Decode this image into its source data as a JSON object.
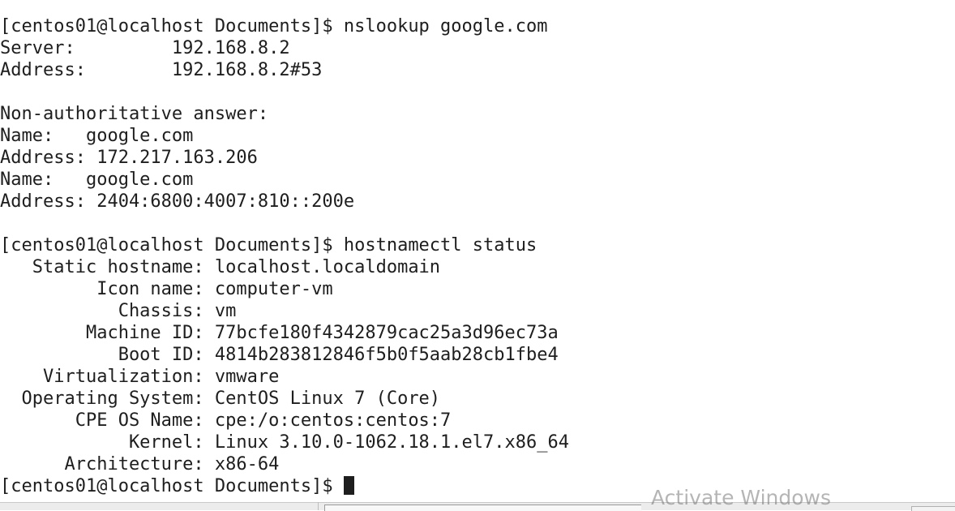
{
  "terminal": {
    "lines": [
      "[centos01@localhost Documents]$ nslookup google.com",
      "Server:         192.168.8.2",
      "Address:        192.168.8.2#53",
      "",
      "Non-authoritative answer:",
      "Name:   google.com",
      "Address: 172.217.163.206",
      "Name:   google.com",
      "Address: 2404:6800:4007:810::200e",
      "",
      "[centos01@localhost Documents]$ hostnamectl status",
      "   Static hostname: localhost.localdomain",
      "         Icon name: computer-vm",
      "           Chassis: vm",
      "        Machine ID: 77bcfe180f4342879cac25a3d96ec73a",
      "           Boot ID: 4814b283812846f5b0f5aab28cb1fbe4",
      "    Virtualization: vmware",
      "  Operating System: CentOS Linux 7 (Core)",
      "       CPE OS Name: cpe:/o:centos:centos:7",
      "            Kernel: Linux 3.10.0-1062.18.1.el7.x86_64",
      "      Architecture: x86-64"
    ],
    "prompt": "[centos01@localhost Documents]$ ",
    "background": "#ffffff",
    "foreground": "#1e1e1e"
  },
  "watermark": {
    "text": "Activate Windows"
  }
}
